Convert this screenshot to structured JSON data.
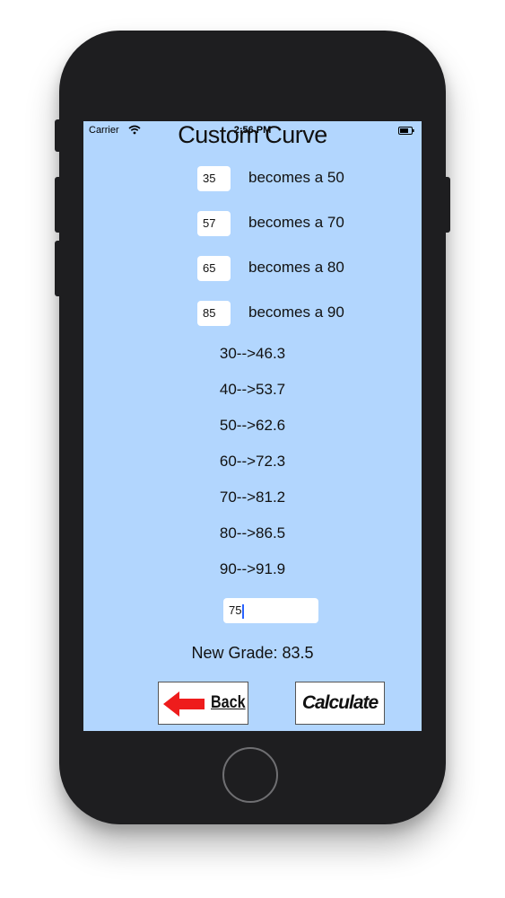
{
  "status_bar": {
    "carrier": "Carrier",
    "time": "2:56 PM",
    "wifi_icon": "wifi-icon",
    "battery_icon": "battery-icon"
  },
  "title": "Custom Curve",
  "curve_points": [
    {
      "input": "35",
      "label": "becomes a 50"
    },
    {
      "input": "57",
      "label": "becomes a 70"
    },
    {
      "input": "65",
      "label": "becomes a 80"
    },
    {
      "input": "85",
      "label": "becomes a 90"
    }
  ],
  "mappings": [
    "30-->46.3",
    "40-->53.7",
    "50-->62.6",
    "60-->72.3",
    "70-->81.2",
    "80-->86.5",
    "90-->91.9"
  ],
  "grade_input": {
    "value": "75"
  },
  "result": "New Grade: 83.5",
  "buttons": {
    "back_label": "Back",
    "back_icon": "arrow-left-icon",
    "calculate_label": "Calculate"
  },
  "colors": {
    "screen_background": "#b2d6fe",
    "phone_body": "#1e1e20",
    "back_arrow": "#ee1c1c"
  }
}
